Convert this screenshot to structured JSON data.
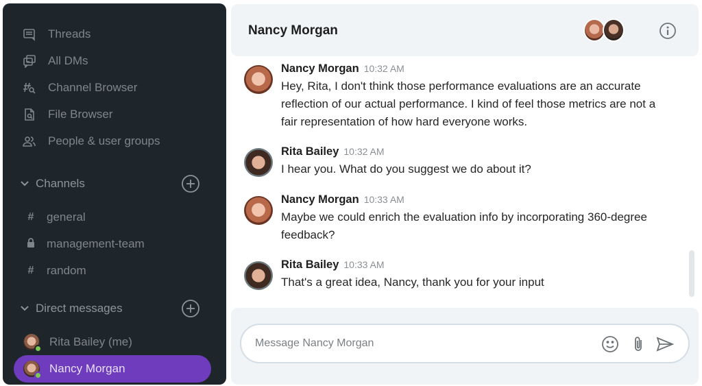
{
  "sidebar": {
    "nav": [
      {
        "label": "Threads",
        "icon": "threads-icon"
      },
      {
        "label": "All DMs",
        "icon": "all-dms-icon"
      },
      {
        "label": "Channel Browser",
        "icon": "channel-browser-icon"
      },
      {
        "label": "File Browser",
        "icon": "file-browser-icon"
      },
      {
        "label": "People & user groups",
        "icon": "people-icon"
      }
    ],
    "channels_header": "Channels",
    "channels": [
      {
        "name": "general",
        "type": "public"
      },
      {
        "name": "management-team",
        "type": "private"
      },
      {
        "name": "random",
        "type": "public"
      }
    ],
    "dms_header": "Direct messages",
    "dms": [
      {
        "name": "Rita Bailey (me)",
        "status": "online",
        "active": false
      },
      {
        "name": "Nancy Morgan",
        "status": "online",
        "active": true
      }
    ]
  },
  "header": {
    "title": "Nancy Morgan",
    "members": [
      "Nancy Morgan",
      "Rita Bailey"
    ]
  },
  "messages": [
    {
      "author": "Nancy Morgan",
      "time": "10:32 AM",
      "text": "Hey, Rita, I don't think those performance evaluations are an accurate reflection of our actual performance. I kind of feel those metrics are not a fair representation of how hard everyone works."
    },
    {
      "author": "Rita Bailey",
      "time": "10:32 AM",
      "text": "I hear you. What do you suggest we do about it?"
    },
    {
      "author": "Nancy Morgan",
      "time": "10:33 AM",
      "text": "Maybe we could enrich the evaluation info by incorporating 360-degree feedback?"
    },
    {
      "author": "Rita Bailey",
      "time": "10:33 AM",
      "text": "That's a great idea, Nancy, thank you for your input"
    }
  ],
  "composer": {
    "placeholder": "Message Nancy Morgan",
    "value": ""
  },
  "colors": {
    "sidebar_bg": "#1f262b",
    "active_item": "#6e3cbc",
    "online": "#7dc652",
    "panel_bg": "#f0f4f7"
  }
}
